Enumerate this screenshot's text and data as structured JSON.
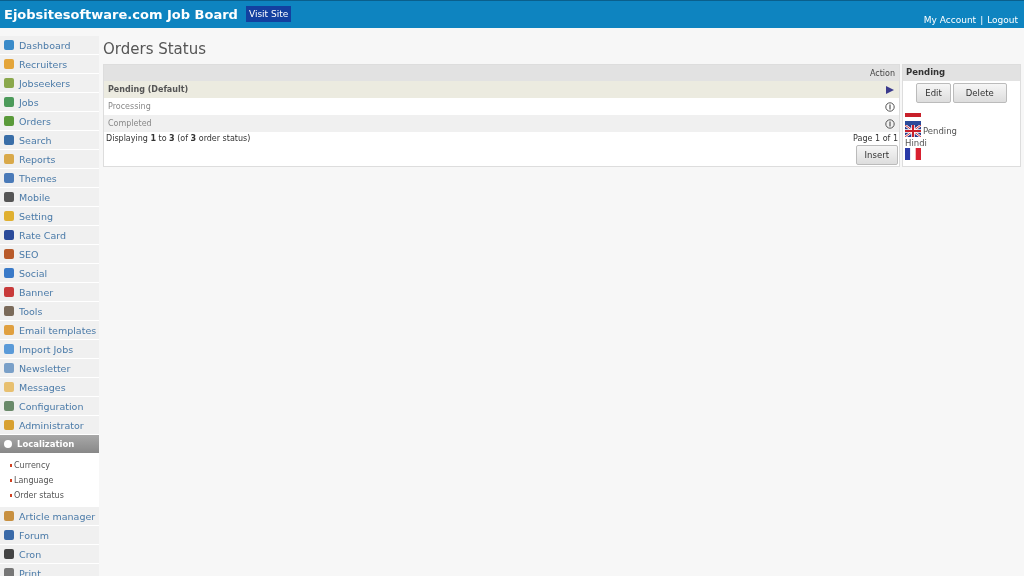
{
  "header": {
    "title": "Ejobsitesoftware.com Job Board",
    "visit_link": "Visit Site",
    "account_link": "My Account",
    "separator": "|",
    "logout_link": "Logout"
  },
  "sidebar": {
    "items": [
      {
        "label": "Dashboard",
        "expanded": false
      },
      {
        "label": "Recruiters",
        "expanded": false
      },
      {
        "label": "Jobseekers",
        "expanded": false
      },
      {
        "label": "Jobs",
        "expanded": false
      },
      {
        "label": "Orders",
        "expanded": false
      },
      {
        "label": "Search",
        "expanded": false
      },
      {
        "label": "Reports",
        "expanded": false
      },
      {
        "label": "Themes",
        "expanded": false
      },
      {
        "label": "Mobile",
        "expanded": false
      },
      {
        "label": "Setting",
        "expanded": false
      },
      {
        "label": "Rate Card",
        "expanded": false
      },
      {
        "label": "SEO",
        "expanded": false
      },
      {
        "label": "Social",
        "expanded": false
      },
      {
        "label": "Banner",
        "expanded": false
      },
      {
        "label": "Tools",
        "expanded": false
      },
      {
        "label": "Email templates",
        "expanded": false
      },
      {
        "label": "Import Jobs",
        "expanded": false
      },
      {
        "label": "Newsletter",
        "expanded": false
      },
      {
        "label": "Messages",
        "expanded": false
      },
      {
        "label": "Configuration",
        "expanded": false
      },
      {
        "label": "Administrator",
        "expanded": false
      },
      {
        "label": "Localization",
        "expanded": true,
        "children": [
          {
            "label": "Currency"
          },
          {
            "label": "Language"
          },
          {
            "label": "Order status"
          }
        ]
      },
      {
        "label": "Article manager",
        "expanded": false
      },
      {
        "label": "Forum",
        "expanded": false
      },
      {
        "label": "Cron",
        "expanded": false
      },
      {
        "label": "Print",
        "expanded": false
      }
    ]
  },
  "page_title": "Orders Status",
  "table": {
    "action_heading": "Action",
    "rows": [
      {
        "name": "Pending (Default)",
        "selected": true
      },
      {
        "name": "Processing",
        "selected": false
      },
      {
        "name": "Completed",
        "selected": false
      }
    ],
    "summary": "Displaying **1** to **3** (of **3** order status)",
    "pagination": "Page 1 of 1",
    "insert_button": "Insert"
  },
  "detail": {
    "title": "Pending",
    "buttons": [
      "Edit",
      "Delete"
    ],
    "translations": [
      {
        "kind": "dutch"
      },
      {
        "kind": "british",
        "text": "Pending"
      },
      {
        "kind": "name",
        "text": "Hindi"
      },
      {
        "kind": "french"
      }
    ]
  }
}
